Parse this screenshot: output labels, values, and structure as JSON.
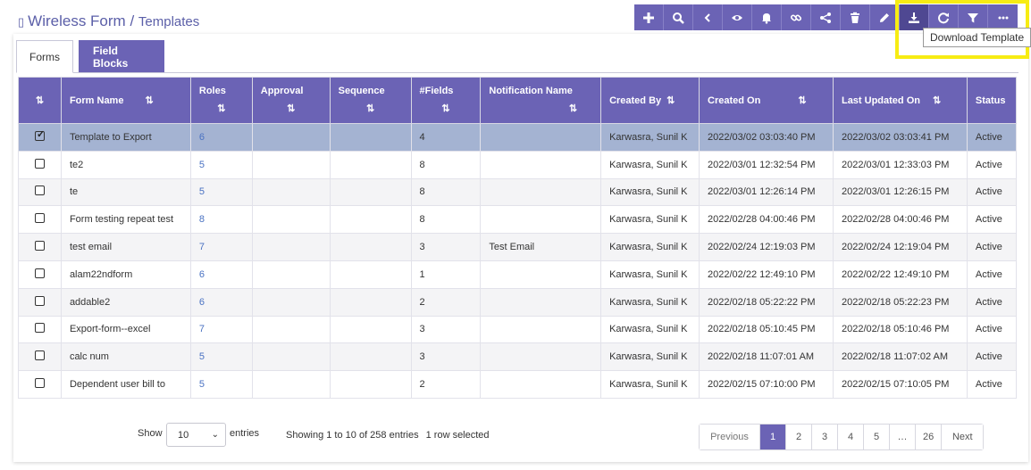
{
  "header": {
    "app_title": "Wireless Form",
    "separator": " / ",
    "subtitle": "Templates"
  },
  "toolbar": {
    "tooltip": "Download Template",
    "buttons": [
      "plus-icon",
      "search-icon",
      "chevron-left-icon",
      "eye-icon",
      "bell-icon",
      "link-icon",
      "share-icon",
      "trash-icon",
      "pencil-icon",
      "download-icon",
      "refresh-icon",
      "filter-icon",
      "more-icon"
    ]
  },
  "tabs": [
    {
      "label": "Forms",
      "active": true
    },
    {
      "label": "Field Blocks",
      "active": false
    }
  ],
  "table": {
    "headers": {
      "form_name": "Form Name",
      "roles": "Roles",
      "approval": "Approval",
      "sequence": "Sequence",
      "fields": "#Fields",
      "notification": "Notification Name",
      "created_by": "Created By",
      "created_on": "Created On",
      "updated_on": "Last Updated On",
      "status": "Status"
    },
    "rows": [
      {
        "checked": true,
        "name": "Template to Export",
        "roles": "6",
        "approval": "",
        "sequence": "",
        "fields": "4",
        "notification": "",
        "created_by": "Karwasra, Sunil K",
        "created_on": "2022/03/02 03:03:40 PM",
        "updated_on": "2022/03/02 03:03:41 PM",
        "status": "Active"
      },
      {
        "checked": false,
        "name": "te2",
        "roles": "5",
        "approval": "",
        "sequence": "",
        "fields": "8",
        "notification": "",
        "created_by": "Karwasra, Sunil K",
        "created_on": "2022/03/01 12:32:54 PM",
        "updated_on": "2022/03/01 12:33:03 PM",
        "status": "Active"
      },
      {
        "checked": false,
        "name": "te",
        "roles": "5",
        "approval": "",
        "sequence": "",
        "fields": "8",
        "notification": "",
        "created_by": "Karwasra, Sunil K",
        "created_on": "2022/03/01 12:26:14 PM",
        "updated_on": "2022/03/01 12:26:15 PM",
        "status": "Active"
      },
      {
        "checked": false,
        "name": "Form testing repeat test",
        "roles": "8",
        "approval": "",
        "sequence": "",
        "fields": "8",
        "notification": "",
        "created_by": "Karwasra, Sunil K",
        "created_on": "2022/02/28 04:00:46 PM",
        "updated_on": "2022/02/28 04:00:46 PM",
        "status": "Active"
      },
      {
        "checked": false,
        "name": "test email",
        "roles": "7",
        "approval": "",
        "sequence": "",
        "fields": "3",
        "notification": "Test Email",
        "created_by": "Karwasra, Sunil K",
        "created_on": "2022/02/24 12:19:03 PM",
        "updated_on": "2022/02/24 12:19:04 PM",
        "status": "Active"
      },
      {
        "checked": false,
        "name": "alam22ndform",
        "roles": "6",
        "approval": "",
        "sequence": "",
        "fields": "1",
        "notification": "",
        "created_by": "Karwasra, Sunil K",
        "created_on": "2022/02/22 12:49:10 PM",
        "updated_on": "2022/02/22 12:49:10 PM",
        "status": "Active"
      },
      {
        "checked": false,
        "name": "addable2",
        "roles": "6",
        "approval": "",
        "sequence": "",
        "fields": "2",
        "notification": "",
        "created_by": "Karwasra, Sunil K",
        "created_on": "2022/02/18 05:22:22 PM",
        "updated_on": "2022/02/18 05:22:23 PM",
        "status": "Active"
      },
      {
        "checked": false,
        "name": "Export-form--excel",
        "roles": "7",
        "approval": "",
        "sequence": "",
        "fields": "3",
        "notification": "",
        "created_by": "Karwasra, Sunil K",
        "created_on": "2022/02/18 05:10:45 PM",
        "updated_on": "2022/02/18 05:10:46 PM",
        "status": "Active"
      },
      {
        "checked": false,
        "name": "calc num",
        "roles": "5",
        "approval": "",
        "sequence": "",
        "fields": "3",
        "notification": "",
        "created_by": "Karwasra, Sunil K",
        "created_on": "2022/02/18 11:07:01 AM",
        "updated_on": "2022/02/18 11:07:02 AM",
        "status": "Active"
      },
      {
        "checked": false,
        "name": "Dependent user bill to",
        "roles": "5",
        "approval": "",
        "sequence": "",
        "fields": "2",
        "notification": "",
        "created_by": "Karwasra, Sunil K",
        "created_on": "2022/02/15 07:10:00 PM",
        "updated_on": "2022/02/15 07:10:05 PM",
        "status": "Active"
      }
    ]
  },
  "footer": {
    "show_label": "Show",
    "page_size": "10",
    "entries_label": "entries",
    "info": "Showing 1 to 10 of 258 entries",
    "selected": "1 row selected"
  },
  "pagination": {
    "prev": "Previous",
    "pages": [
      "1",
      "2",
      "3",
      "4",
      "5",
      "…",
      "26"
    ],
    "active_page": "1",
    "next": "Next"
  },
  "colors": {
    "accent": "#6b63b5",
    "selected_row": "#a4b3d2",
    "link": "#4a72c2",
    "highlight": "#f7ec13"
  }
}
